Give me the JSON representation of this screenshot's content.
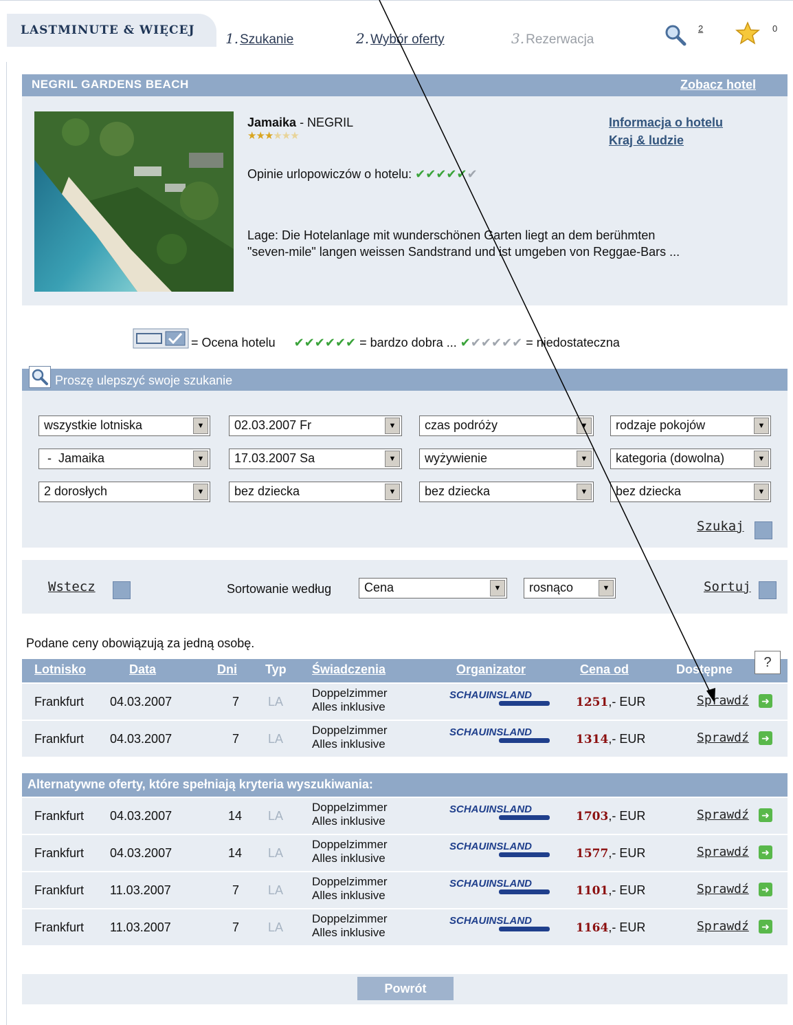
{
  "header": {
    "brand": "LASTMINUTE & WIĘCEJ",
    "steps": [
      {
        "num": "1.",
        "label": "Szukanie"
      },
      {
        "num": "2.",
        "label": "Wybór oferty"
      },
      {
        "num": "3.",
        "label": "Rezerwacja"
      }
    ],
    "search_count": "2",
    "favorites_count": "0"
  },
  "hotel": {
    "name": "NEGRIL GARDENS BEACH",
    "see_hotel": "Zobacz hotel",
    "country": "Jamaika",
    "region": " - NEGRIL",
    "stars_rating": 3,
    "stars_total": 6,
    "opinions_label": "Opinie urlopowiczów o hotelu:",
    "opinions_rating": 5,
    "opinions_total": 6,
    "info_link": "Informacja o hotelu",
    "country_link": "Kraj & ludzie",
    "description_line1": "Lage: Die Hotelanlage mit wunderschönen Garten liegt an dem berühmten",
    "description_line2": "\"seven-mile\" langen weissen Sandstrand und ist umgeben von Reggae-Bars ..."
  },
  "legend": {
    "rating_label": "= Ocena hotelu",
    "very_good": "= bardzo dobra ...",
    "insufficient": "= niedostateczna"
  },
  "search": {
    "title": "Proszę ulepszyć swoje szukanie",
    "fields": [
      [
        "wszystkie lotniska",
        "02.03.2007 Fr",
        "czas podróży",
        "rodzaje pokojów"
      ],
      [
        " -  Jamaika",
        "17.03.2007 Sa",
        "wyżywienie",
        "kategoria (dowolna)"
      ],
      [
        "2 dorosłych",
        "bez dziecka",
        "bez dziecka",
        "bez dziecka"
      ]
    ],
    "search_button": "Szukaj"
  },
  "sort": {
    "back_label": "Wstecz",
    "sort_by_label": "Sortowanie według",
    "sort_field": "Cena",
    "sort_order": "rosnąco",
    "sort_button": "Sortuj"
  },
  "results": {
    "price_note": "Podane ceny obowiązują za jedną osobę.",
    "columns": [
      "Lotnisko",
      "Data",
      "Dni",
      "Typ",
      "Świadczenia",
      "Organizator",
      "Cena od",
      "Dostępne"
    ],
    "help": "?",
    "alt_header": "Alternatywne oferty, które spełniają kryteria wyszukiwania:",
    "organizer": "SCHAUINSLAND",
    "currency": ",- EUR",
    "check_label": "Sprawdź",
    "rows": [
      {
        "airport": "Frankfurt",
        "date": "04.03.2007",
        "days": "7",
        "type": "LA",
        "room": "Doppelzimmer",
        "board": "Alles inklusive",
        "price": "1251"
      },
      {
        "airport": "Frankfurt",
        "date": "04.03.2007",
        "days": "7",
        "type": "LA",
        "room": "Doppelzimmer",
        "board": "Alles inklusive",
        "price": "1314"
      }
    ],
    "alt_rows": [
      {
        "airport": "Frankfurt",
        "date": "04.03.2007",
        "days": "14",
        "type": "LA",
        "room": "Doppelzimmer",
        "board": "Alles inklusive",
        "price": "1703"
      },
      {
        "airport": "Frankfurt",
        "date": "04.03.2007",
        "days": "14",
        "type": "LA",
        "room": "Doppelzimmer",
        "board": "Alles inklusive",
        "price": "1577"
      },
      {
        "airport": "Frankfurt",
        "date": "11.03.2007",
        "days": "7",
        "type": "LA",
        "room": "Doppelzimmer",
        "board": "Alles inklusive",
        "price": "1101"
      },
      {
        "airport": "Frankfurt",
        "date": "11.03.2007",
        "days": "7",
        "type": "LA",
        "room": "Doppelzimmer",
        "board": "Alles inklusive",
        "price": "1164"
      }
    ],
    "back_button": "Powrót"
  },
  "icons": {
    "search": "magnifier-icon",
    "favorites": "star-icon",
    "check": "checkmark-icon",
    "arrow": "green-arrow-icon"
  },
  "colors": {
    "panel_header": "#8fa8c7",
    "panel_bg": "#e8edf3",
    "price": "#8b0f0f",
    "organizer_logo": "#1f3f8c"
  }
}
